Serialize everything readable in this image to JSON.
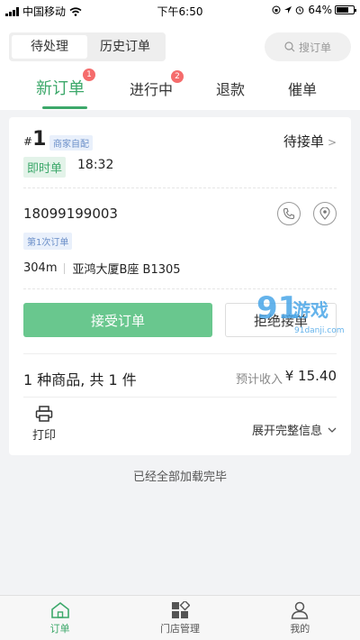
{
  "status_bar": {
    "carrier": "中国移动",
    "time": "下午6:50",
    "battery": "64%"
  },
  "header": {
    "segment": [
      "待处理",
      "历史订单"
    ],
    "search_placeholder": "搜订单",
    "tabs": [
      {
        "label": "新订单",
        "badge": "1"
      },
      {
        "label": "进行中",
        "badge": "2"
      },
      {
        "label": "退款",
        "badge": ""
      },
      {
        "label": "催单",
        "badge": ""
      }
    ]
  },
  "order": {
    "number_prefix": "#",
    "number": "1",
    "source_tag": "商家自配",
    "status": "待接单",
    "instant_tag": "即时单",
    "time": "18:32",
    "phone": "18099199003",
    "first_order_tag": "第1次订单",
    "distance": "304m",
    "address": "亚鸿大厦B座 B1305",
    "accept_label": "接受订单",
    "reject_label": "拒绝接单",
    "goods_summary": "1 种商品, 共 1 件",
    "income_label": "预计收入",
    "income_value": "¥ 15.40",
    "print_label": "打印",
    "expand_label": "展开完整信息"
  },
  "footer_text": "已经全部加载完毕",
  "watermark": {
    "big": "91",
    "text": "游戏",
    "url": "91danji.com"
  },
  "bottom_nav": [
    {
      "label": "订单",
      "icon": "home-icon"
    },
    {
      "label": "门店管理",
      "icon": "grid-icon"
    },
    {
      "label": "我的",
      "icon": "user-icon"
    }
  ],
  "colors": {
    "accent": "#3ca86a",
    "badge": "#f56c6c",
    "tag_blue": "#6b8fc9"
  }
}
